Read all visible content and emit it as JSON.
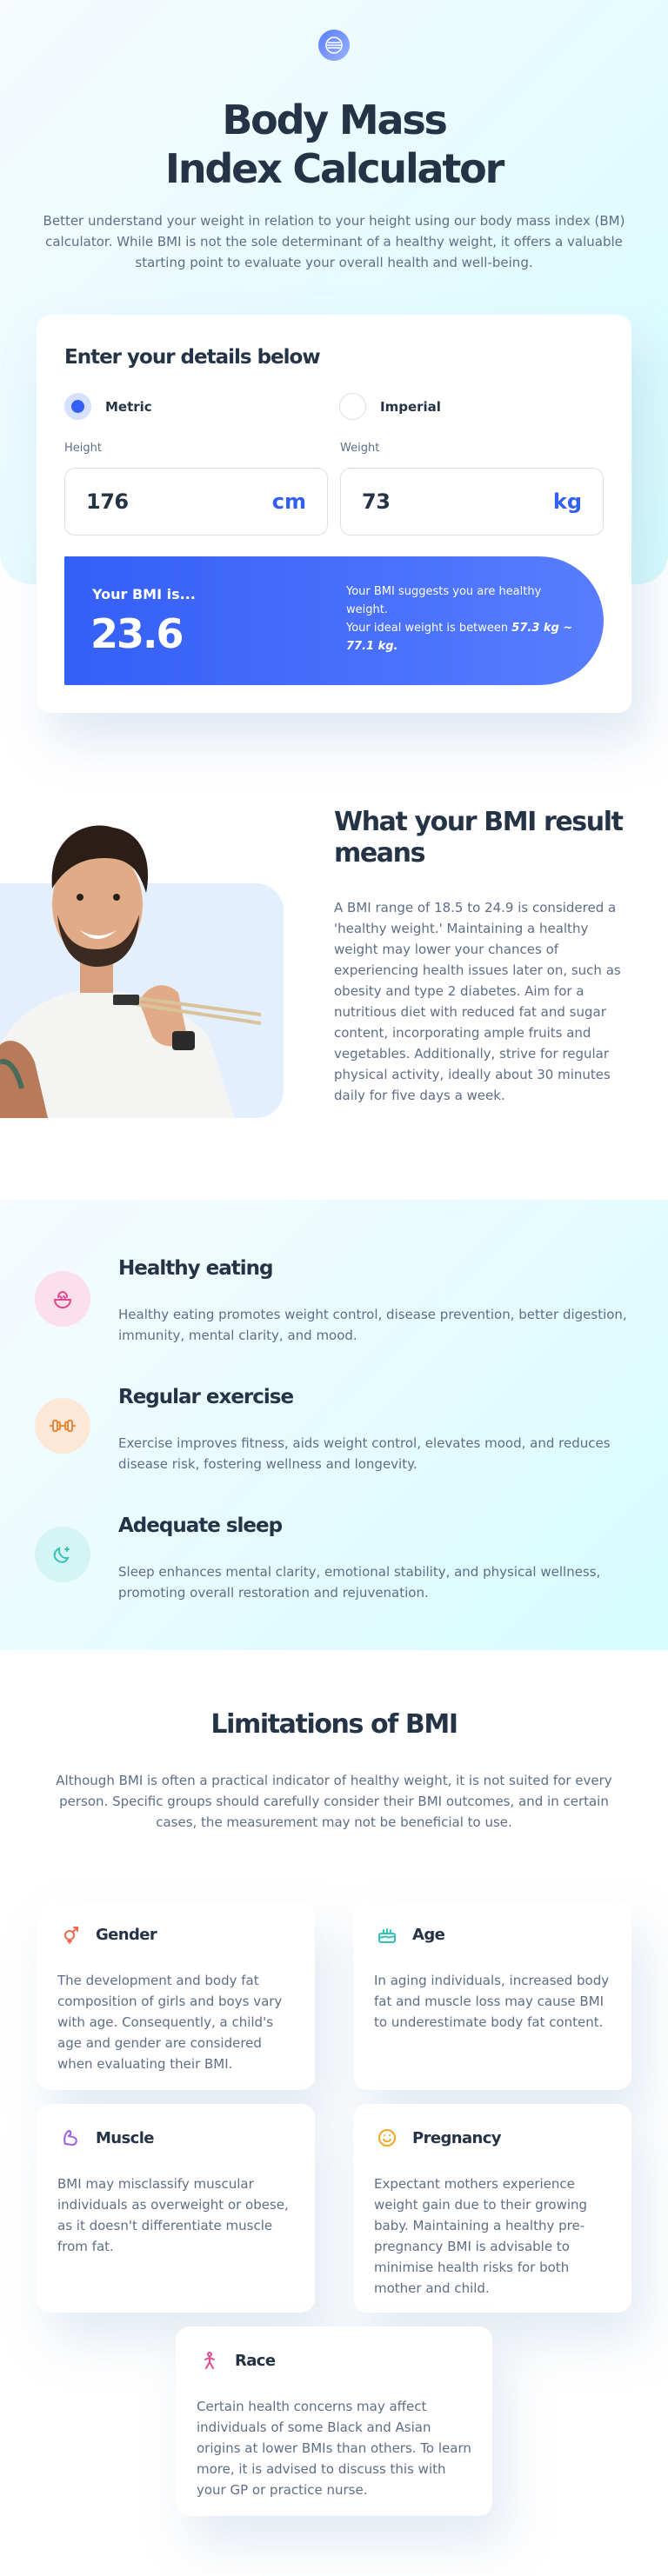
{
  "hero": {
    "title_line1": "Body Mass",
    "title_line2": "Index Calculator",
    "description": "Better understand your weight in relation to your height using our body mass index (BM) calculator. While BMI is not the sole determinant of a healthy weight, it offers a valuable starting point to evaluate your overall health and well-being."
  },
  "calculator": {
    "title": "Enter your details below",
    "units": [
      {
        "label": "Metric",
        "selected": true
      },
      {
        "label": "Imperial",
        "selected": false
      }
    ],
    "height": {
      "label": "Height",
      "value": "176",
      "unit": "cm"
    },
    "weight": {
      "label": "Weight",
      "value": "73",
      "unit": "kg"
    },
    "result": {
      "label": "Your BMI is...",
      "value": "23.6",
      "message_line1": "Your BMI suggests you are healthy weight.",
      "message_prefix": "Your ideal weight is between ",
      "ideal_range": "57.3 kg ~ 77.1 kg."
    }
  },
  "meaning": {
    "title": "What your BMI result means",
    "text": "A BMI range of 18.5 to 24.9 is considered a 'healthy weight.' Maintaining a healthy weight may lower your chances of experiencing health issues later on, such as obesity and type 2 diabetes. Aim for a nutritious diet with reduced fat and sugar content, incorporating ample fruits and vegetables. Additionally, strive for regular physical activity, ideally about 30 minutes daily for five days a week."
  },
  "tips": [
    {
      "icon": "food-bowl-icon",
      "color": "#e24a8c",
      "bg": "#fbdfec",
      "title": "Healthy eating",
      "text": "Healthy eating promotes weight control, disease prevention, better digestion, immunity, mental clarity, and mood."
    },
    {
      "icon": "dumbbell-icon",
      "color": "#e8893a",
      "bg": "#fde8d8",
      "title": "Regular exercise",
      "text": "Exercise improves fitness, aids weight control, elevates mood, and reduces disease risk, fostering wellness and longevity."
    },
    {
      "icon": "moon-icon",
      "color": "#33c3b6",
      "bg": "#d4f5f3",
      "title": "Adequate sleep",
      "text": "Sleep enhances mental clarity, emotional stability, and physical wellness, promoting overall restoration and rejuvenation."
    }
  ],
  "limitations": {
    "title": "Limitations of BMI",
    "description": "Although BMI is often a practical indicator of healthy weight, it is not suited for every person. Specific groups should carefully consider their BMI outcomes, and in certain cases, the measurement may not be beneficial to use.",
    "items": [
      {
        "icon": "gender-icon",
        "color": "#f2654e",
        "title": "Gender",
        "text": "The development and body fat composition of girls and boys vary with age. Consequently, a child's age and gender are considered when evaluating their BMI."
      },
      {
        "icon": "birthday-cake-icon",
        "color": "#33c3b6",
        "title": "Age",
        "text": "In aging individuals, increased body fat and muscle loss may cause BMI to underestimate body fat content."
      },
      {
        "icon": "flexed-arm-icon",
        "color": "#9b5de5",
        "title": "Muscle",
        "text": "BMI may misclassify muscular individuals as overweight or obese, as it doesn't differentiate muscle from fat."
      },
      {
        "icon": "pregnancy-icon",
        "color": "#f5a623",
        "title": "Pregnancy",
        "text": "Expectant mothers experience weight gain due to their growing baby. Maintaining a healthy pre-pregnancy BMI is advisable to minimise health risks for both mother and child."
      },
      {
        "icon": "race-icon",
        "color": "#e24a8c",
        "title": "Race",
        "text": "Certain health concerns may affect individuals of some Black and Asian origins at lower BMIs than others. To learn more, it is advised to discuss this with your GP or practice nurse."
      }
    ]
  }
}
